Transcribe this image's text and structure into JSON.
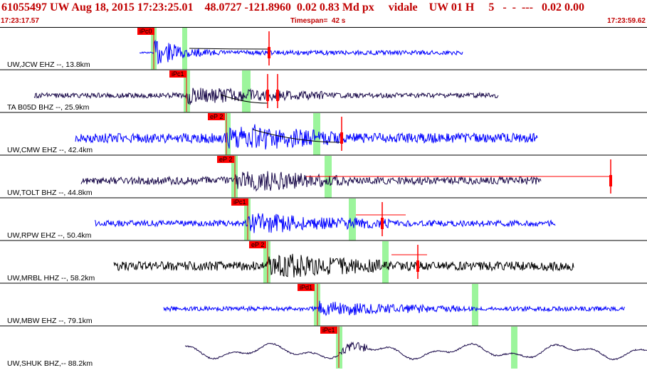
{
  "header": {
    "title": "61055497 UW Aug 18, 2015 17:23:25.01    48.0727 -121.8960  0.02 0.83 Md px     vidale    UW 01 H     5   -  -  ---   0.02 0.00",
    "start_time": "17:23:17.57",
    "timespan": "Timespan=  42 s",
    "end_time": "17:23:59.62"
  },
  "colors": {
    "title_red": "#c00000",
    "trace_blue": "#0000ff",
    "trace_navy": "#1a0a4a",
    "trace_black": "#000000",
    "pick_red": "#ff0000",
    "window_green": "#9cf59c",
    "tt_curve": "#000000"
  },
  "traces": [
    {
      "label": "UW,JCW EHZ --, 13.8km",
      "pick": "iPc0",
      "color": "blue",
      "amp": 0.75,
      "style": "burst"
    },
    {
      "label": "TA B05D BHZ --, 25.9km",
      "pick": "iPc1",
      "color": "navy",
      "amp": 0.5,
      "style": "noise"
    },
    {
      "label": "UW,CMW EHZ --, 42.4km",
      "pick": "eP 2",
      "color": "blue",
      "amp": 0.7,
      "style": "dense"
    },
    {
      "label": "UW,TOLT BHZ --, 44.8km",
      "pick": "eP 2",
      "color": "navy",
      "amp": 0.55,
      "style": "dense"
    },
    {
      "label": "UW,RPW EHZ --, 50.4km",
      "pick": "iPc1",
      "color": "blue",
      "amp": 0.6,
      "style": "noise"
    },
    {
      "label": "UW,MRBL HHZ --, 58.2km",
      "pick": "eP 2",
      "color": "black",
      "amp": 0.65,
      "style": "dense"
    },
    {
      "label": "UW,MBW EHZ --, 79.1km",
      "pick": "iPd1",
      "color": "blue",
      "amp": 0.45,
      "style": "noise"
    },
    {
      "label": "UW,SHUK BHZ,-- 88.2km",
      "pick": "iPc1",
      "color": "navy",
      "amp": 0.55,
      "style": "long"
    }
  ]
}
